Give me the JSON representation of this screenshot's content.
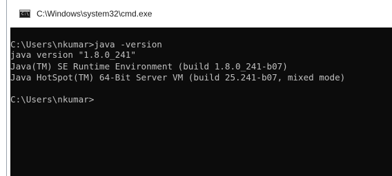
{
  "window": {
    "title": "C:\\Windows\\system32\\cmd.exe",
    "icon": "cmd-icon",
    "icon_glyph": "C:\\"
  },
  "console": {
    "background": "#0c0c0c",
    "text_color": "#c0c0c0",
    "lines": [
      "C:\\Users\\nkumar>java -version",
      "java version \"1.8.0_241\"",
      "Java(TM) SE Runtime Environment (build 1.8.0_241-b07)",
      "Java HotSpot(TM) 64-Bit Server VM (build 25.241-b07, mixed mode)",
      "C:\\Users\\nkumar>"
    ]
  }
}
